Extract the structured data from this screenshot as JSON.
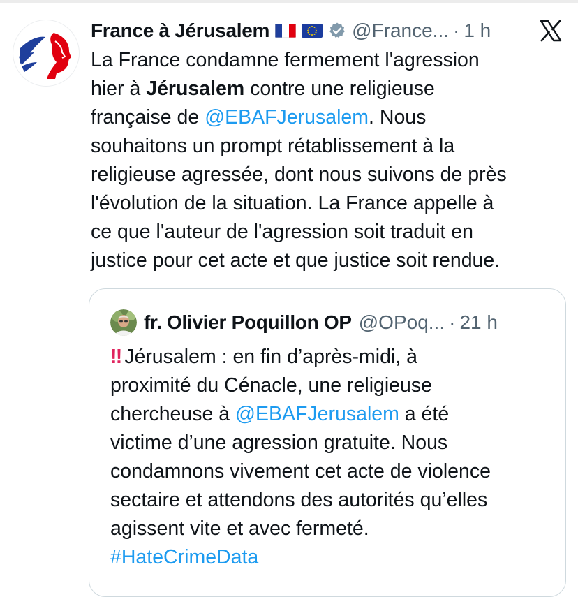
{
  "tweet": {
    "author_name": "France à Jérusalem",
    "flags": [
      "france-flag-icon",
      "eu-flag-icon"
    ],
    "handle": "@France...",
    "separator": "·",
    "time": "1 h",
    "lines": [
      [
        "La France condamne fermement l'agression"
      ],
      [
        "hier à ",
        "Jérusalem",
        " contre une religieuse"
      ],
      [
        "française de ",
        "@EBAFJerusalem",
        ". Nous"
      ],
      [
        "souhaitons un prompt rétablissement à la"
      ],
      [
        "religieuse agressée,  dont nous suivons de près"
      ],
      [
        "l'évolution de la situation. La France appelle à"
      ],
      [
        "ce que l'auteur de l'agression soit traduit en"
      ],
      [
        "justice pour cet acte et que justice soit rendue."
      ]
    ]
  },
  "quote": {
    "author_name": "fr. Olivier Poquillon OP",
    "handle": "@OPoq...",
    "separator": "·",
    "time": "21 h",
    "emoji": "‼",
    "lines": [
      [
        "Jérusalem : en fin d’après-midi, à"
      ],
      [
        "proximité du Cénacle, une religieuse"
      ],
      [
        "chercheuse à ",
        "@EBAFJerusalem",
        " a été"
      ],
      [
        "victime d’une agression gratuite. Nous"
      ],
      [
        "condamnons vivement cet acte de violence"
      ],
      [
        "sectaire et attendons des autorités qu’elles"
      ],
      [
        "agissent vite et avec fermeté."
      ],
      [
        "#HateCrimeData"
      ]
    ]
  },
  "colors": {
    "text": "#0f1419",
    "secondary": "#536471",
    "link": "#1d9bf0",
    "border": "#cfd9de",
    "verified": "#829aab"
  }
}
